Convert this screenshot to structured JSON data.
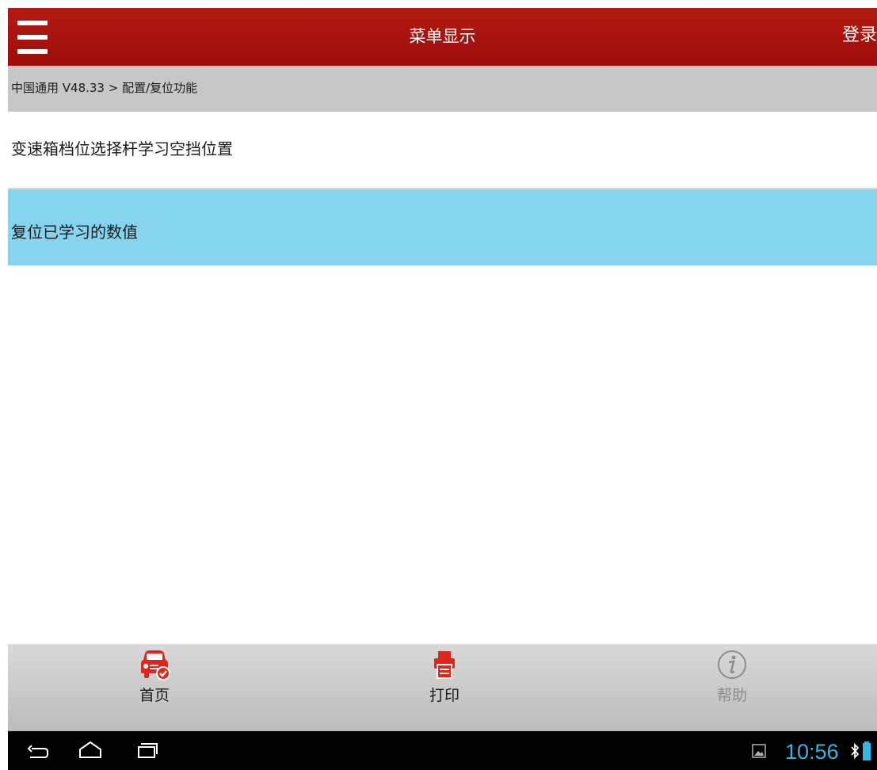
{
  "header": {
    "title": "菜单显示",
    "login_label": "登录"
  },
  "breadcrumb": {
    "text": "中国通用 V48.33 > 配置/复位功能"
  },
  "menu": {
    "items": [
      {
        "label": "变速箱档位选择杆学习空挡位置",
        "selected": false
      },
      {
        "label": "复位已学习的数值",
        "selected": true
      }
    ]
  },
  "toolbar": {
    "home_label": "首页",
    "print_label": "打印",
    "help_label": "帮助",
    "accent_color": "#e0261c",
    "disabled_color": "#8c8c8c"
  },
  "system_bar": {
    "time": "10:56",
    "icons": [
      "back-icon",
      "home-icon",
      "recent-apps-icon",
      "gallery-icon",
      "bluetooth-icon",
      "battery-icon"
    ]
  },
  "colors": {
    "header_bg": "#a8120e",
    "breadcrumb_bg": "#c7c7c7",
    "selected_bg": "#86d3ee",
    "clock": "#33b5e5"
  }
}
